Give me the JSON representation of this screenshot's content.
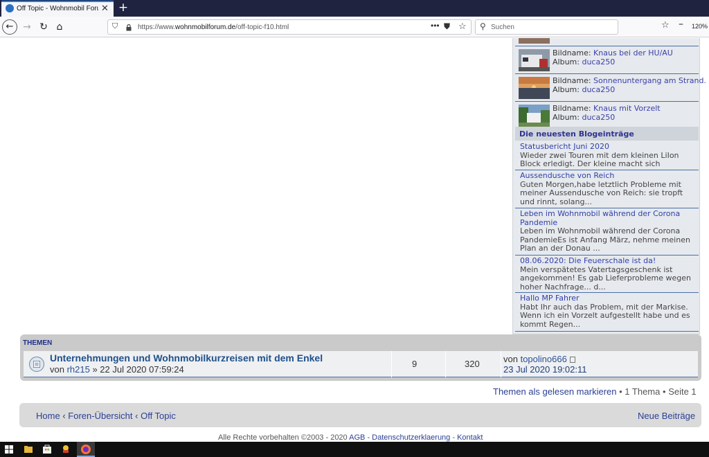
{
  "browser": {
    "tab_title": "Off Topic - Wohnmobil Forum",
    "new_tab_label": "+",
    "url_prefix": "https://www.",
    "url_domain": "wohnmobilforum.de",
    "url_path": "/off-topic-f10.html",
    "search_placeholder": "Suchen",
    "zoom_level": "120%"
  },
  "sidebar": {
    "gallery": [
      {
        "bild_label": "Bildname:",
        "bild": "Knaus bei der HU/AU",
        "album_label": "Album:",
        "album": "duca250"
      },
      {
        "bild_label": "Bildname:",
        "bild": "Sonnenuntergang am Strand.",
        "album_label": "Album:",
        "album": "duca250"
      },
      {
        "bild_label": "Bildname:",
        "bild": "Knaus mit Vorzelt",
        "album_label": "Album:",
        "album": "duca250"
      }
    ],
    "blog_heading": "Die neuesten Blogeinträge",
    "blogs": [
      {
        "title": "Statusbericht Juni 2020",
        "excerpt": "Wieder zwei Touren mit dem kleinen LiIon Block erledigt. Der kleine macht sich prächtig, reicht fü..."
      },
      {
        "title": "Aussendusche von Reich",
        "excerpt": "Guten Morgen,habe letztlich Probleme mit meiner Aussendusche von Reich: sie tropft und rinnt, solang..."
      },
      {
        "title": "Leben im Wohnmobil während der Corona Pandemie",
        "excerpt": "Leben im Wohnmobil während der Corona PandemieEs ist Anfang März, nehme meinen Plan an der Donau ..."
      },
      {
        "title": "08.06.2020: Die Feuerschale ist da!",
        "excerpt": "Mein verspätetes Vatertagsgeschenk ist angekommen! Es gab Lieferprobleme wegen hoher Nachfrage... d..."
      },
      {
        "title": "Hallo MP Fahrer",
        "excerpt": "Habt Ihr auch das Problem, mit der Markise. Wenn ich ein Vorzelt aufgestellt habe und es kommt Regen..."
      }
    ]
  },
  "topics": {
    "heading": "THEMEN",
    "row": {
      "title": "Unternehmungen und Wohnmobilkurzreisen mit dem Enkel",
      "by_label": "von",
      "author": "rh215",
      "date": "» 22 Jul 2020 07:59:24",
      "replies": "9",
      "views": "320",
      "last_by_label": "von",
      "last_author": "topolino666",
      "last_date": "23 Jul 2020 19:02:11"
    }
  },
  "pagination": {
    "mark_read": "Themen als gelesen markieren",
    "bullet": "•",
    "count": "1 Thema",
    "page": "Seite 1"
  },
  "breadcrumb": {
    "home": "Home",
    "sep": "‹",
    "forum": "Foren-Übersicht",
    "current": "Off Topic",
    "new_posts": "Neue Beiträge"
  },
  "footer": {
    "copyright": "Alle Rechte vorbehalten ©2003 - 2020",
    "agb": "AGB",
    "dash": "-",
    "privacy": "Datenschutzerklaerung",
    "contact": "Kontakt"
  },
  "colors": {
    "tab_bar": "#202340",
    "link_blue": "#2a3f94",
    "topic_title": "#1f4f8a"
  },
  "icons": {
    "back": "arrow-left",
    "forward": "arrow-right",
    "reload": "reload",
    "home": "house",
    "shield": "tracking-shield",
    "lock": "padlock",
    "page_actions": "three-dots",
    "pocket": "pocket",
    "bookmark": "star",
    "search": "magnifier",
    "library": "library",
    "zoom_out": "minus",
    "topic": "topic-read"
  }
}
